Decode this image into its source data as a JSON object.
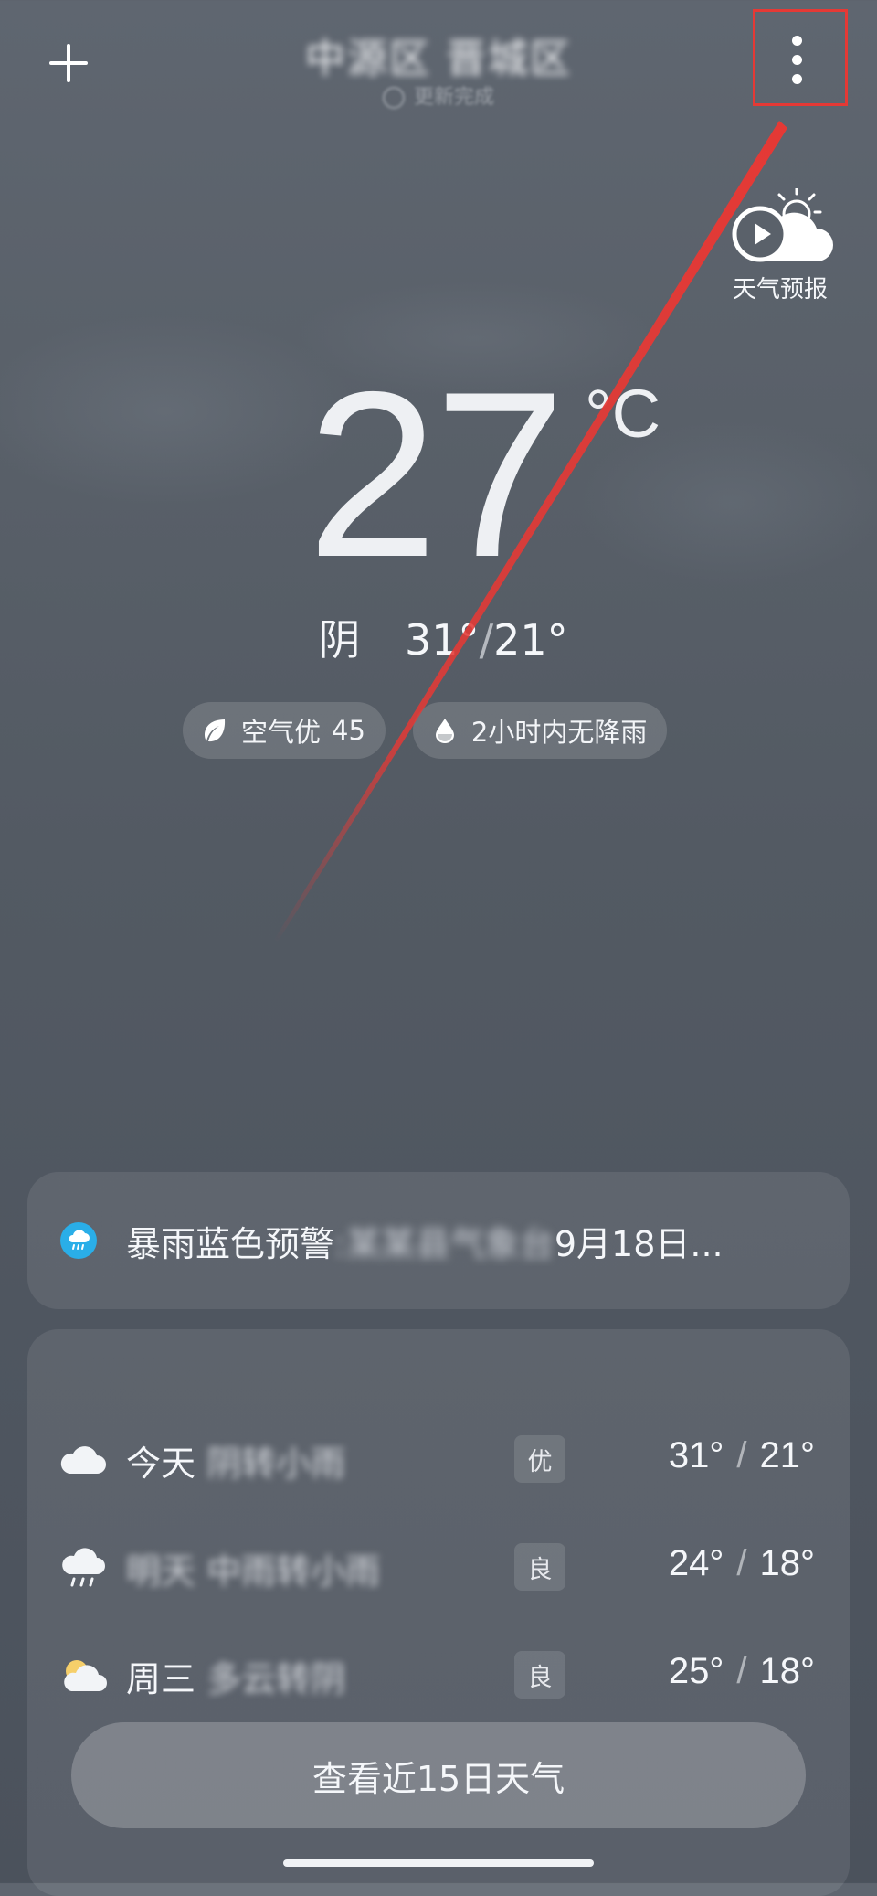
{
  "header": {
    "location": "中源区 晋城区",
    "update_status": "更新完成"
  },
  "forecast_video": {
    "label": "天气预报"
  },
  "current": {
    "temperature": "27",
    "unit": "°C",
    "condition": "阴",
    "high": "31°",
    "separator": "/",
    "low": "21°"
  },
  "chips": {
    "air": {
      "label": "空气优",
      "value": "45"
    },
    "rain": {
      "label": "2小时内无降雨"
    }
  },
  "alert": {
    "title": "暴雨蓝色预警",
    "colon": ":",
    "redacted_source": "某某县气象台",
    "date_text": "9月18日..."
  },
  "forecast": {
    "days": [
      {
        "day": "今天",
        "condition": "阴转小雨",
        "aqi": "优",
        "high": "31°",
        "low": "21°",
        "icon": "cloud-icon"
      },
      {
        "day": "明天",
        "condition": "中雨转小雨",
        "aqi": "良",
        "high": "24°",
        "low": "18°",
        "icon": "rain-icon"
      },
      {
        "day": "周三",
        "condition": "多云转阴",
        "aqi": "良",
        "high": "25°",
        "low": "18°",
        "icon": "partly-cloudy-icon"
      }
    ],
    "separator": "/",
    "view_more_label": "查看近15日天气"
  },
  "colors": {
    "accent_red": "#e53935",
    "alert_blue": "#2aaee8",
    "background": "#555c66"
  }
}
